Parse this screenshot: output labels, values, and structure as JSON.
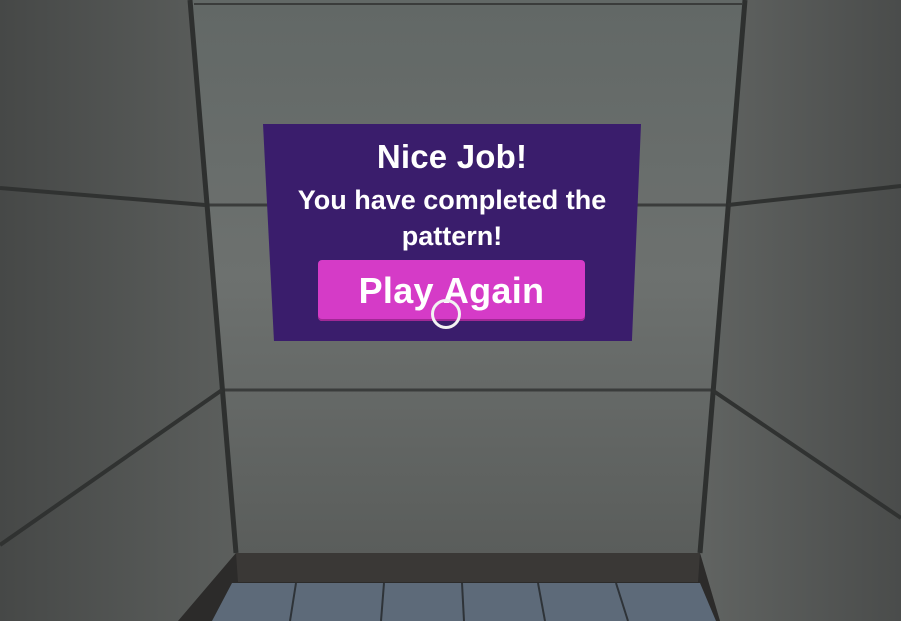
{
  "popup": {
    "title": "Nice Job!",
    "message": "You have completed the pattern!",
    "button_label": "Play Again"
  },
  "colors": {
    "popup_background": "#3a1d6c",
    "button_background": "#d53bc7",
    "text": "#ffffff",
    "floor_tiles": "#5d6a79"
  }
}
